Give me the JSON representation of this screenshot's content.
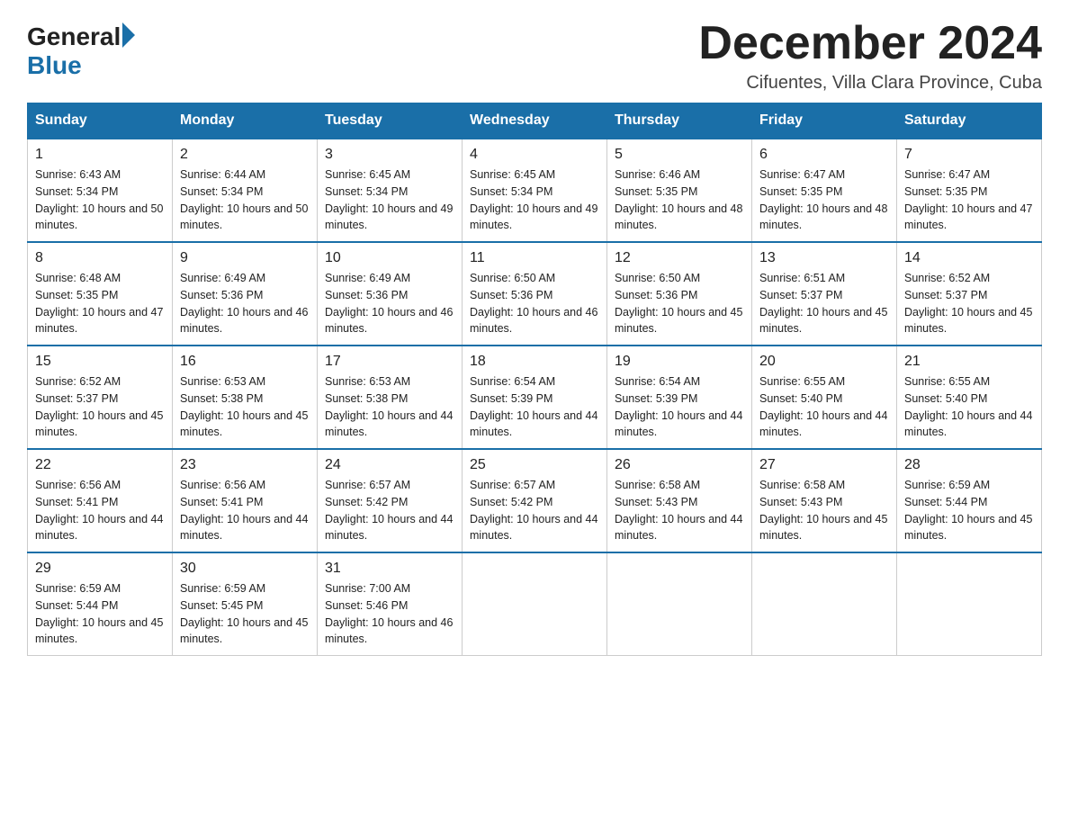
{
  "logo": {
    "general": "General",
    "blue": "Blue"
  },
  "title": "December 2024",
  "subtitle": "Cifuentes, Villa Clara Province, Cuba",
  "days_of_week": [
    "Sunday",
    "Monday",
    "Tuesday",
    "Wednesday",
    "Thursday",
    "Friday",
    "Saturday"
  ],
  "weeks": [
    [
      {
        "day": "1",
        "sunrise": "6:43 AM",
        "sunset": "5:34 PM",
        "daylight": "10 hours and 50 minutes."
      },
      {
        "day": "2",
        "sunrise": "6:44 AM",
        "sunset": "5:34 PM",
        "daylight": "10 hours and 50 minutes."
      },
      {
        "day": "3",
        "sunrise": "6:45 AM",
        "sunset": "5:34 PM",
        "daylight": "10 hours and 49 minutes."
      },
      {
        "day": "4",
        "sunrise": "6:45 AM",
        "sunset": "5:34 PM",
        "daylight": "10 hours and 49 minutes."
      },
      {
        "day": "5",
        "sunrise": "6:46 AM",
        "sunset": "5:35 PM",
        "daylight": "10 hours and 48 minutes."
      },
      {
        "day": "6",
        "sunrise": "6:47 AM",
        "sunset": "5:35 PM",
        "daylight": "10 hours and 48 minutes."
      },
      {
        "day": "7",
        "sunrise": "6:47 AM",
        "sunset": "5:35 PM",
        "daylight": "10 hours and 47 minutes."
      }
    ],
    [
      {
        "day": "8",
        "sunrise": "6:48 AM",
        "sunset": "5:35 PM",
        "daylight": "10 hours and 47 minutes."
      },
      {
        "day": "9",
        "sunrise": "6:49 AM",
        "sunset": "5:36 PM",
        "daylight": "10 hours and 46 minutes."
      },
      {
        "day": "10",
        "sunrise": "6:49 AM",
        "sunset": "5:36 PM",
        "daylight": "10 hours and 46 minutes."
      },
      {
        "day": "11",
        "sunrise": "6:50 AM",
        "sunset": "5:36 PM",
        "daylight": "10 hours and 46 minutes."
      },
      {
        "day": "12",
        "sunrise": "6:50 AM",
        "sunset": "5:36 PM",
        "daylight": "10 hours and 45 minutes."
      },
      {
        "day": "13",
        "sunrise": "6:51 AM",
        "sunset": "5:37 PM",
        "daylight": "10 hours and 45 minutes."
      },
      {
        "day": "14",
        "sunrise": "6:52 AM",
        "sunset": "5:37 PM",
        "daylight": "10 hours and 45 minutes."
      }
    ],
    [
      {
        "day": "15",
        "sunrise": "6:52 AM",
        "sunset": "5:37 PM",
        "daylight": "10 hours and 45 minutes."
      },
      {
        "day": "16",
        "sunrise": "6:53 AM",
        "sunset": "5:38 PM",
        "daylight": "10 hours and 45 minutes."
      },
      {
        "day": "17",
        "sunrise": "6:53 AM",
        "sunset": "5:38 PM",
        "daylight": "10 hours and 44 minutes."
      },
      {
        "day": "18",
        "sunrise": "6:54 AM",
        "sunset": "5:39 PM",
        "daylight": "10 hours and 44 minutes."
      },
      {
        "day": "19",
        "sunrise": "6:54 AM",
        "sunset": "5:39 PM",
        "daylight": "10 hours and 44 minutes."
      },
      {
        "day": "20",
        "sunrise": "6:55 AM",
        "sunset": "5:40 PM",
        "daylight": "10 hours and 44 minutes."
      },
      {
        "day": "21",
        "sunrise": "6:55 AM",
        "sunset": "5:40 PM",
        "daylight": "10 hours and 44 minutes."
      }
    ],
    [
      {
        "day": "22",
        "sunrise": "6:56 AM",
        "sunset": "5:41 PM",
        "daylight": "10 hours and 44 minutes."
      },
      {
        "day": "23",
        "sunrise": "6:56 AM",
        "sunset": "5:41 PM",
        "daylight": "10 hours and 44 minutes."
      },
      {
        "day": "24",
        "sunrise": "6:57 AM",
        "sunset": "5:42 PM",
        "daylight": "10 hours and 44 minutes."
      },
      {
        "day": "25",
        "sunrise": "6:57 AM",
        "sunset": "5:42 PM",
        "daylight": "10 hours and 44 minutes."
      },
      {
        "day": "26",
        "sunrise": "6:58 AM",
        "sunset": "5:43 PM",
        "daylight": "10 hours and 44 minutes."
      },
      {
        "day": "27",
        "sunrise": "6:58 AM",
        "sunset": "5:43 PM",
        "daylight": "10 hours and 45 minutes."
      },
      {
        "day": "28",
        "sunrise": "6:59 AM",
        "sunset": "5:44 PM",
        "daylight": "10 hours and 45 minutes."
      }
    ],
    [
      {
        "day": "29",
        "sunrise": "6:59 AM",
        "sunset": "5:44 PM",
        "daylight": "10 hours and 45 minutes."
      },
      {
        "day": "30",
        "sunrise": "6:59 AM",
        "sunset": "5:45 PM",
        "daylight": "10 hours and 45 minutes."
      },
      {
        "day": "31",
        "sunrise": "7:00 AM",
        "sunset": "5:46 PM",
        "daylight": "10 hours and 46 minutes."
      },
      null,
      null,
      null,
      null
    ]
  ]
}
